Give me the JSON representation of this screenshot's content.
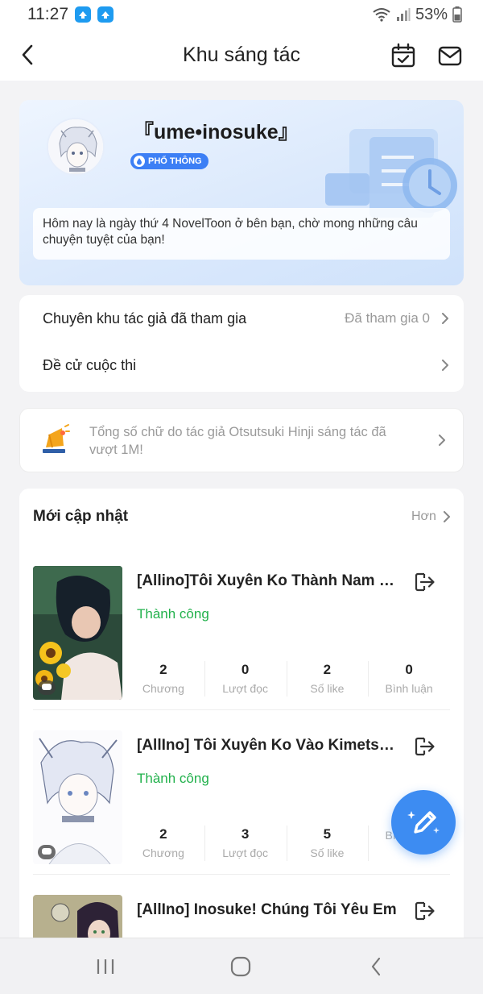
{
  "status_bar": {
    "time": "11:27",
    "battery": "53%"
  },
  "header": {
    "title": "Khu sáng tác"
  },
  "profile": {
    "name": "『ume•inosuke』",
    "badge": "PHỔ THÔNG",
    "greeting": "Hôm nay là ngày thứ 4 NovelToon ở bên bạn, chờ mong những câu chuyện tuyệt của bạn!"
  },
  "menu": {
    "items": [
      {
        "label": "Chuyên khu tác giả đã tham gia",
        "value": "Đã tham gia 0"
      },
      {
        "label": "Đề cử cuộc thi",
        "value": ""
      }
    ]
  },
  "notice": {
    "text": "Tổng số chữ do tác giả Otsutsuki Hinji sáng tác đã vượt 1M!"
  },
  "updates": {
    "title": "Mới cập nhật",
    "more": "Hơn",
    "works": [
      {
        "title": "[Allino]Tôi Xuyên Ko Thành Nam Chính…",
        "status": "Thành công",
        "stats": [
          {
            "value": "2",
            "label": "Chương"
          },
          {
            "value": "0",
            "label": "Lượt đọc"
          },
          {
            "value": "2",
            "label": "Số like"
          },
          {
            "value": "0",
            "label": "Bình luận"
          }
        ]
      },
      {
        "title": "[AllIno] Tôi Xuyên Ko Vào Kimetsu no Yaiba",
        "status": "Thành công",
        "stats": [
          {
            "value": "2",
            "label": "Chương"
          },
          {
            "value": "3",
            "label": "Lượt đọc"
          },
          {
            "value": "5",
            "label": "Số like"
          },
          {
            "value": "",
            "label": "Bình luận"
          }
        ]
      },
      {
        "title": "[AllIno] Inosuke! Chúng Tôi Yêu Em",
        "status": "",
        "stats": []
      }
    ]
  },
  "colors": {
    "accent": "#3d8cf2",
    "success": "#22b14c",
    "badge": "#3c7ff5"
  }
}
